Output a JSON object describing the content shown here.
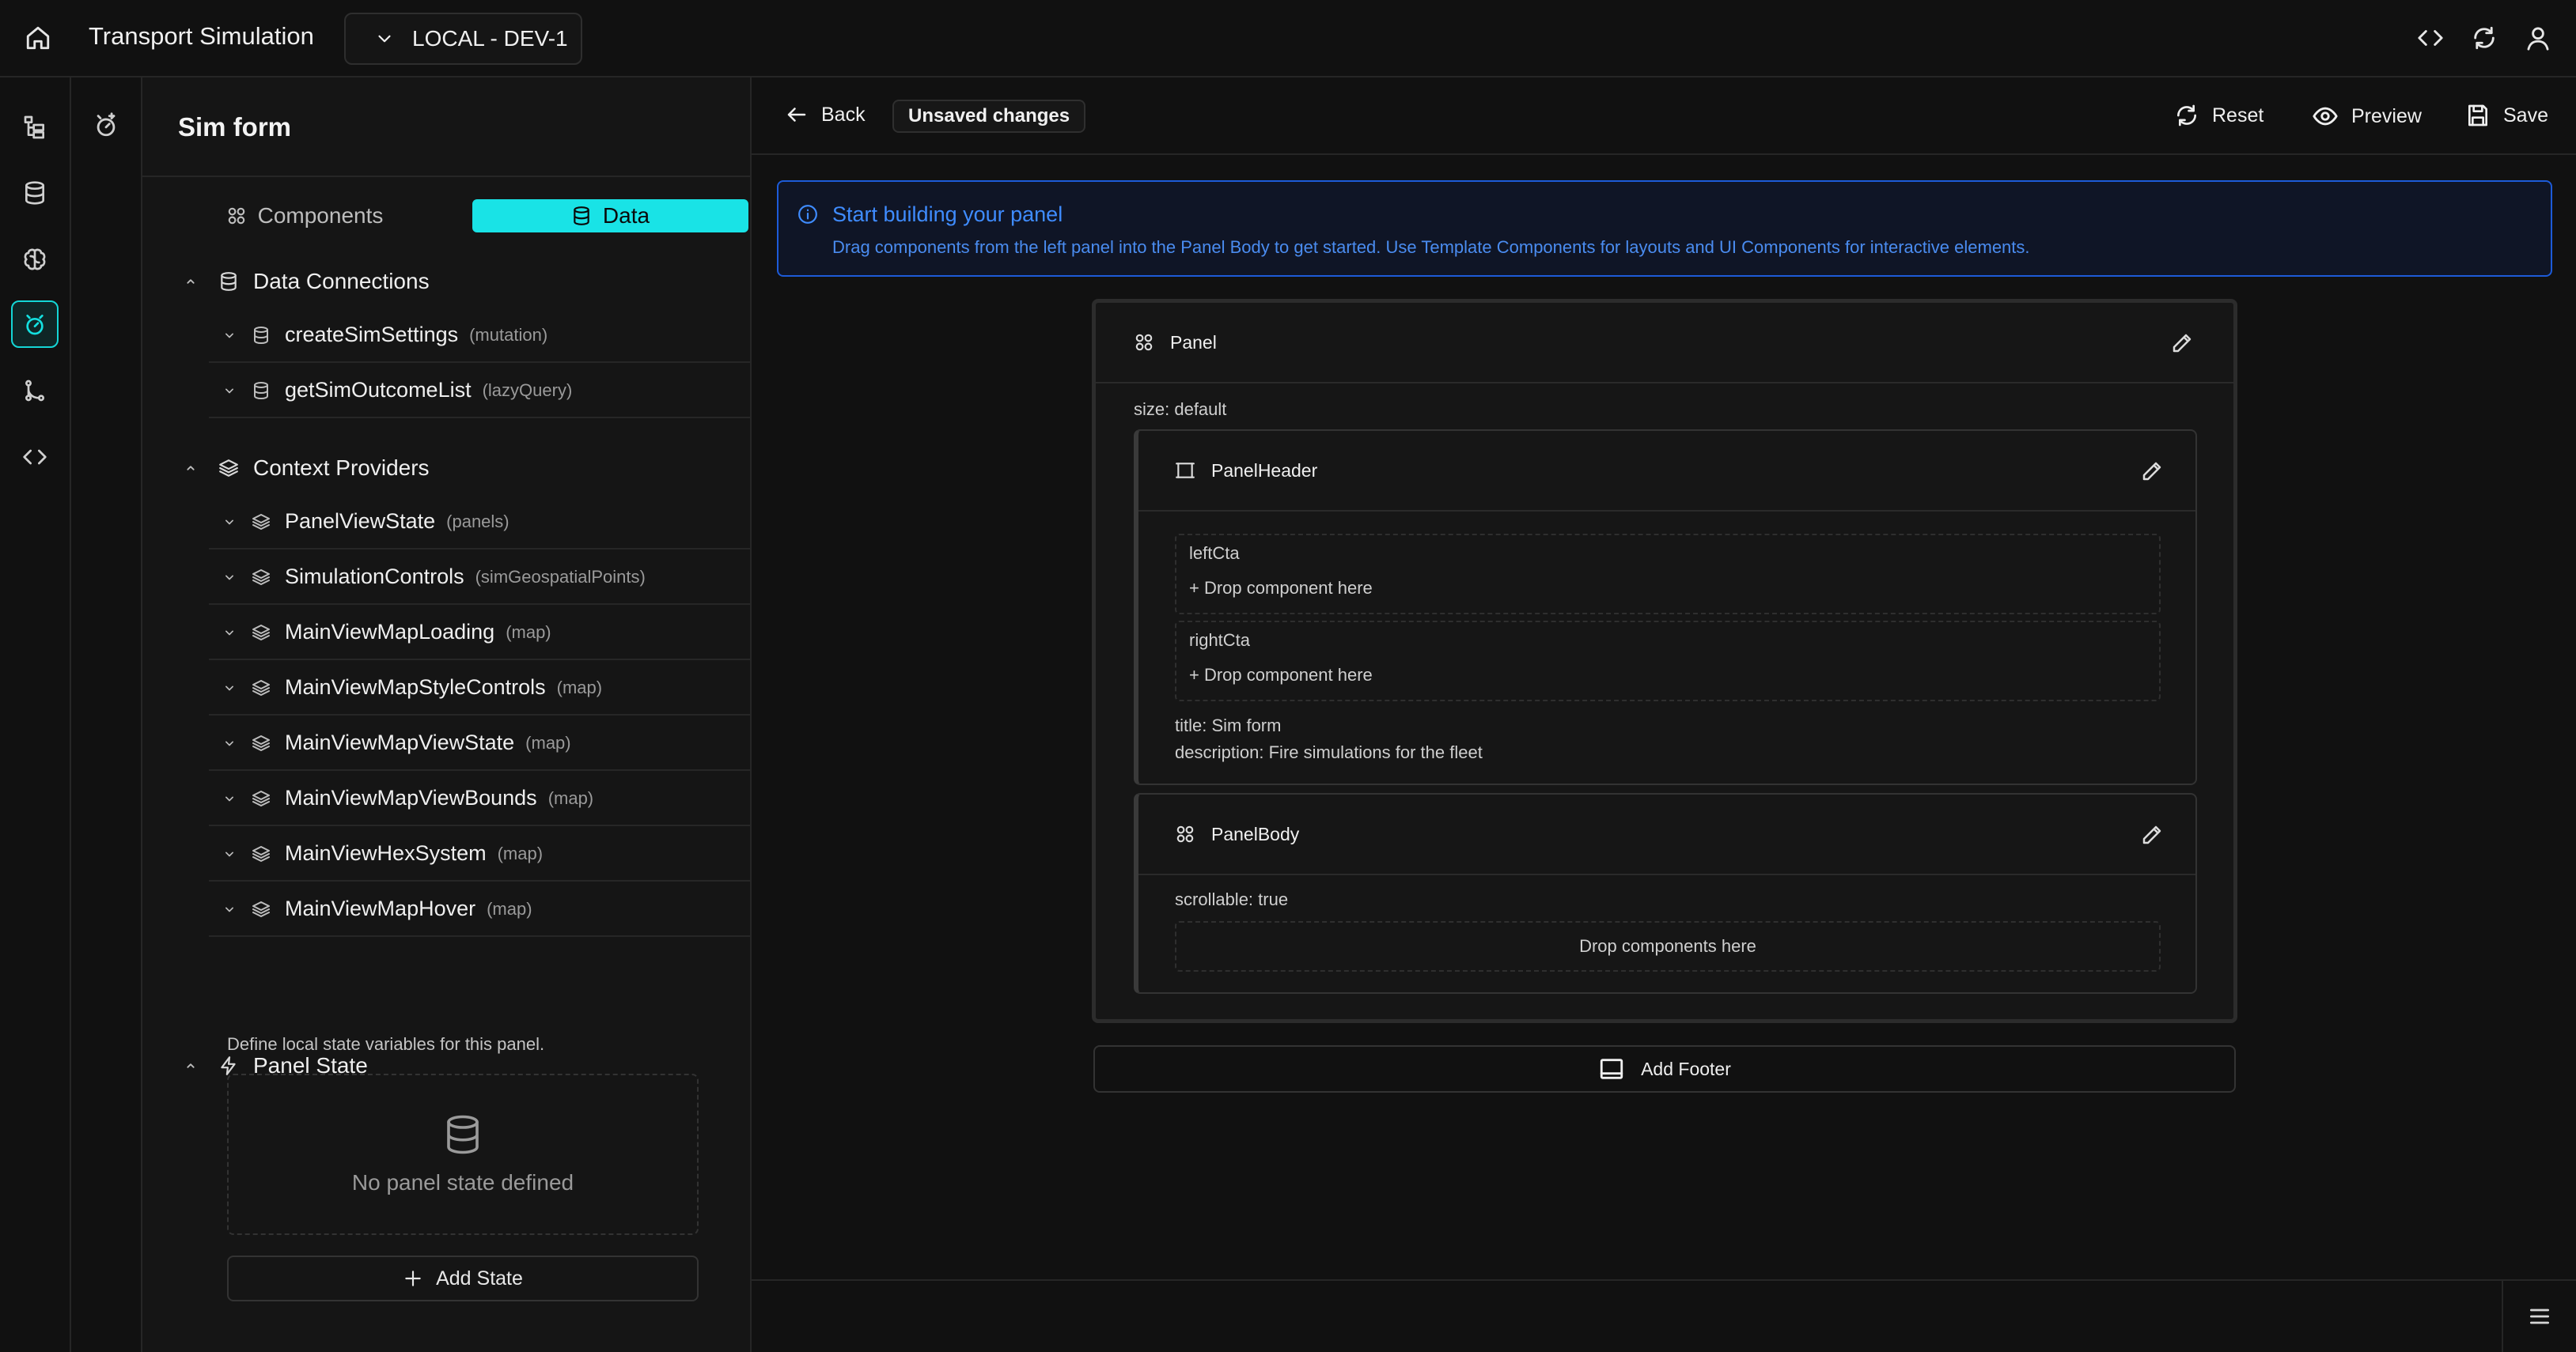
{
  "header": {
    "app_title": "Transport Simulation",
    "environment": "LOCAL - DEV-1",
    "icons": [
      "home-icon",
      "code-icon",
      "refresh-icon",
      "user-icon"
    ]
  },
  "rail": {
    "items": [
      "tree-icon",
      "database-icon",
      "brain-icon",
      "panel-builder-icon",
      "git-branch-icon",
      "code-icon"
    ],
    "active": "panel-builder-icon"
  },
  "side_panel": {
    "title": "Sim form",
    "tabs": {
      "components": "Components",
      "data": "Data",
      "active": "Data"
    },
    "data_connections": {
      "title": "Data Connections",
      "items": [
        {
          "name": "createSimSettings",
          "tag": "(mutation)"
        },
        {
          "name": "getSimOutcomeList",
          "tag": "(lazyQuery)"
        }
      ]
    },
    "context_providers": {
      "title": "Context Providers",
      "items": [
        {
          "name": "PanelViewState",
          "tag": "(panels)"
        },
        {
          "name": "SimulationControls",
          "tag": "(simGeospatialPoints)"
        },
        {
          "name": "MainViewMapLoading",
          "tag": "(map)"
        },
        {
          "name": "MainViewMapStyleControls",
          "tag": "(map)"
        },
        {
          "name": "MainViewMapViewState",
          "tag": "(map)"
        },
        {
          "name": "MainViewMapViewBounds",
          "tag": "(map)"
        },
        {
          "name": "MainViewHexSystem",
          "tag": "(map)"
        },
        {
          "name": "MainViewMapHover",
          "tag": "(map)"
        }
      ]
    },
    "panel_state": {
      "title": "Panel State",
      "description": "Define local state variables for this panel.",
      "empty_text": "No panel state defined",
      "add_label": "Add State"
    }
  },
  "main": {
    "back_label": "Back",
    "unsaved_label": "Unsaved changes",
    "reset_label": "Reset",
    "preview_label": "Preview",
    "save_label": "Save",
    "info": {
      "title": "Start building your panel",
      "text": "Drag components from the left panel into the Panel Body to get started. Use Template Components for layouts and UI Components for interactive elements."
    },
    "panel": {
      "title": "Panel",
      "size_prop": "size: default",
      "header": {
        "title": "PanelHeader",
        "slots": [
          {
            "name": "leftCta",
            "drop": "Drop component here"
          },
          {
            "name": "rightCta",
            "drop": "Drop component here"
          }
        ],
        "title_prop": "title: Sim form",
        "description_prop": "description: Fire simulations for the fleet"
      },
      "body": {
        "title": "PanelBody",
        "scrollable_prop": "scrollable: true",
        "drop": "Drop components here"
      }
    },
    "add_footer_label": "Add Footer"
  },
  "colors": {
    "accent": "#19e3e6",
    "info_border": "#1d5bd8",
    "info_text": "#3f8cff",
    "background": "#111111"
  }
}
